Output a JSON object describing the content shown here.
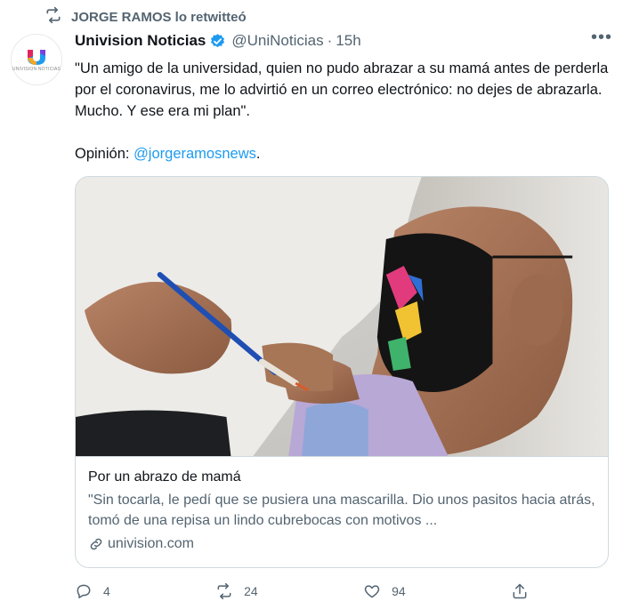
{
  "retweet": {
    "text": "JORGE RAMOS lo retwitteó",
    "icon": "retweet-icon"
  },
  "author": {
    "name": "Univision Noticias",
    "handle": "@UniNoticias",
    "separator": "·",
    "time": "15h",
    "verified_color": "#1d9bf0",
    "avatar_text": "UNIVISION NOTICIAS"
  },
  "tweet": {
    "text": "\"Un amigo de la universidad, quien no pudo abrazar a su mamá antes de perderla por el coronavirus, me lo advirtió en un correo electrónico: no dejes de abrazarla. Mucho. Y ese era mi plan\".",
    "opinion_label": "Opinión:",
    "mention": "@jorgeramosnews",
    "period": "."
  },
  "card": {
    "title": "Por un abrazo de mamá",
    "description": "\"Sin tocarla, le pedí que se pusiera una mascarilla. Dio unos pasitos hacia atrás, tomó de una repisa un lindo cubrebocas con motivos ...",
    "domain": "univision.com"
  },
  "actions": {
    "reply_count": "4",
    "retweet_count": "24",
    "like_count": "94"
  },
  "colors": {
    "accent": "#1d9bf0",
    "secondary_text": "#536471",
    "border": "#cfd9de"
  }
}
